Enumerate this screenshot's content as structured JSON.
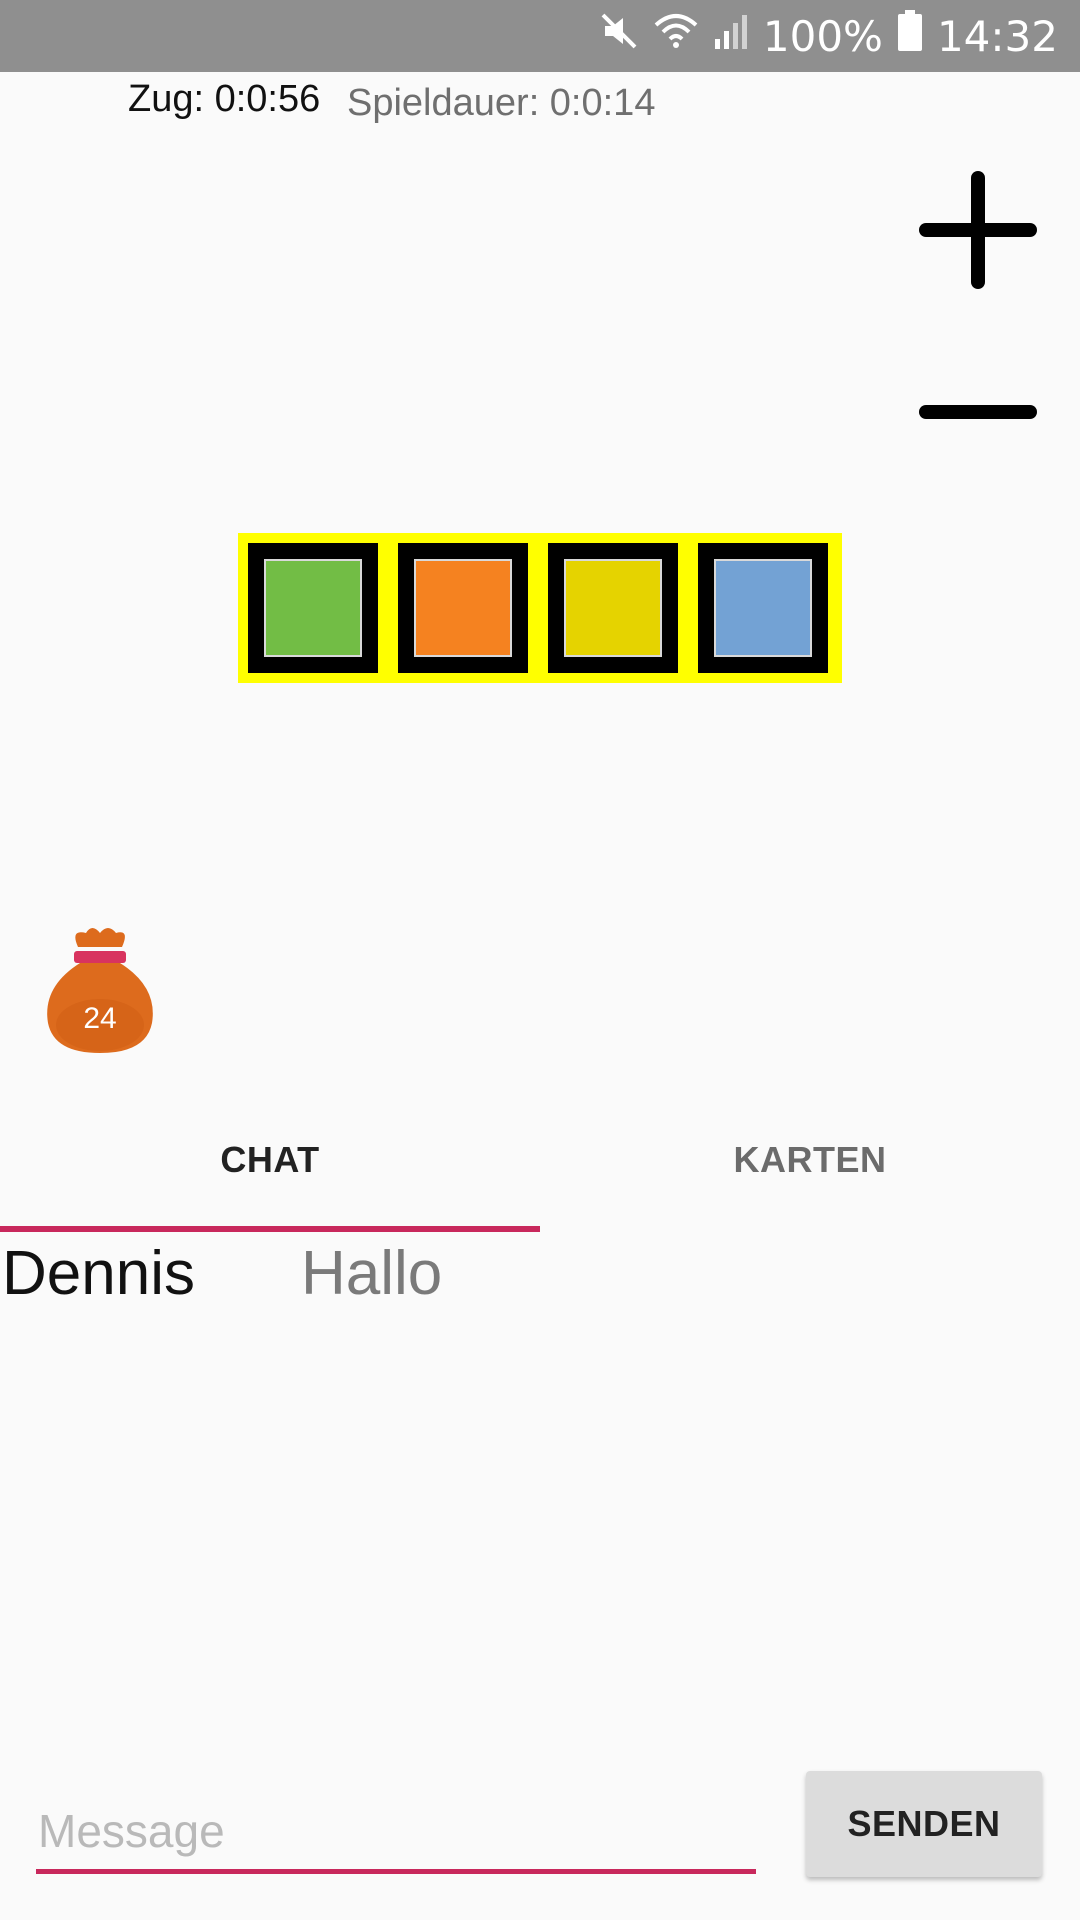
{
  "status_bar": {
    "battery": "100%",
    "time": "14:32",
    "icons": [
      "mute-icon",
      "wifi-icon",
      "signal-icon",
      "battery-icon"
    ]
  },
  "timers": {
    "turn": "Zug: 0:0:56",
    "game": "Spieldauer: 0:0:14"
  },
  "zoom": {
    "plus_icon": "plus-icon",
    "minus_icon": "minus-icon"
  },
  "board": {
    "border_color": "#ffff00",
    "tiles": [
      {
        "color": "#72bd45"
      },
      {
        "color": "#f58220"
      },
      {
        "color": "#e5d300"
      },
      {
        "color": "#73a2d4"
      }
    ]
  },
  "bag": {
    "count": "24",
    "icon": "bag-icon",
    "color": "#dd6b1d"
  },
  "tabs": [
    {
      "label": "CHAT",
      "active": true
    },
    {
      "label": "KARTEN",
      "active": false
    }
  ],
  "chat": {
    "messages": [
      {
        "sender": "Dennis",
        "text": "Hallo"
      }
    ]
  },
  "composer": {
    "placeholder": "Message",
    "value": "",
    "send_label": "SENDEN"
  },
  "colors": {
    "accent": "#c8285c",
    "status_bar": "#8f8f8f"
  }
}
